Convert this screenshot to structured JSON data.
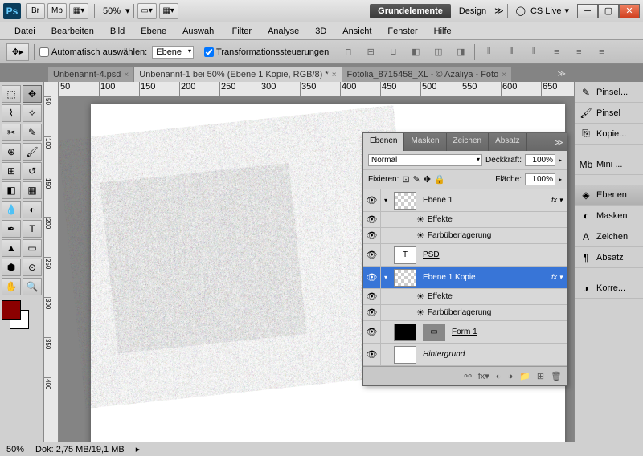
{
  "titlebar": {
    "br": "Br",
    "mb": "Mb",
    "zoom": "50%",
    "workspace": "Grundelemente",
    "design": "Design",
    "cslive": "CS Live"
  },
  "menu": [
    "Datei",
    "Bearbeiten",
    "Bild",
    "Ebene",
    "Auswahl",
    "Filter",
    "Analyse",
    "3D",
    "Ansicht",
    "Fenster",
    "Hilfe"
  ],
  "options": {
    "auto": "Automatisch auswählen:",
    "layer": "Ebene",
    "trans": "Transformationssteuerungen"
  },
  "tabs": [
    {
      "label": "Unbenannt-4.psd",
      "active": false
    },
    {
      "label": "Unbenannt-1 bei 50% (Ebene 1 Kopie, RGB/8) *",
      "active": true
    },
    {
      "label": "Fotolia_8715458_XL - © Azaliya - Foto",
      "active": false
    }
  ],
  "ruler_h": [
    "50",
    "100",
    "150",
    "200",
    "250",
    "300",
    "350",
    "400",
    "450",
    "500",
    "550",
    "600",
    "650"
  ],
  "ruler_v": [
    "50",
    "100",
    "150",
    "200",
    "250",
    "300",
    "350",
    "400"
  ],
  "stamp": "PS",
  "right": [
    {
      "l": "Pinsel...",
      "i": "✎"
    },
    {
      "l": "Pinsel",
      "i": "🖌"
    },
    {
      "l": "Kopie...",
      "i": "⎘"
    },
    {
      "gap": true
    },
    {
      "l": "Mini ...",
      "i": "Mb"
    },
    {
      "gap": true
    },
    {
      "l": "Ebenen",
      "i": "◈",
      "sel": true
    },
    {
      "l": "Masken",
      "i": "◐"
    },
    {
      "l": "Zeichen",
      "i": "A"
    },
    {
      "l": "Absatz",
      "i": "¶"
    },
    {
      "gap": true
    },
    {
      "l": "Korre...",
      "i": "◑"
    }
  ],
  "panel": {
    "tabs": [
      "Ebenen",
      "Masken",
      "Zeichen",
      "Absatz"
    ],
    "blend": "Normal",
    "opacity_l": "Deckkraft:",
    "opacity": "100%",
    "lock_l": "Fixieren:",
    "fill_l": "Fläche:",
    "fill": "100%",
    "layers": [
      {
        "eye": true,
        "thumb": "checker",
        "name": "Ebene 1",
        "fx": true,
        "tw": "▾"
      },
      {
        "sub": true,
        "name": "Effekte",
        "eye": true,
        "icon": "☀"
      },
      {
        "sub": true,
        "name": "Farbüberlagerung",
        "eye": true,
        "icon": "☀"
      },
      {
        "eye": true,
        "thumb": "T",
        "name": "PSD",
        "link": true
      },
      {
        "eye": true,
        "thumb": "checker",
        "name": "Ebene 1 Kopie",
        "fx": true,
        "sel": true,
        "tw": "▾"
      },
      {
        "sub": true,
        "name": "Effekte",
        "eye": true,
        "icon": "☀"
      },
      {
        "sub": true,
        "name": "Farbüberlagerung",
        "eye": true,
        "icon": "☀"
      },
      {
        "eye": true,
        "thumb": "black",
        "thumb2": "shape",
        "name": "Form 1",
        "link": true
      },
      {
        "eye": true,
        "thumb": "white",
        "name": "Hintergrund",
        "italic": true
      }
    ]
  },
  "status": {
    "zoom": "50%",
    "doc": "Dok: 2,75 MB/19,1 MB"
  }
}
